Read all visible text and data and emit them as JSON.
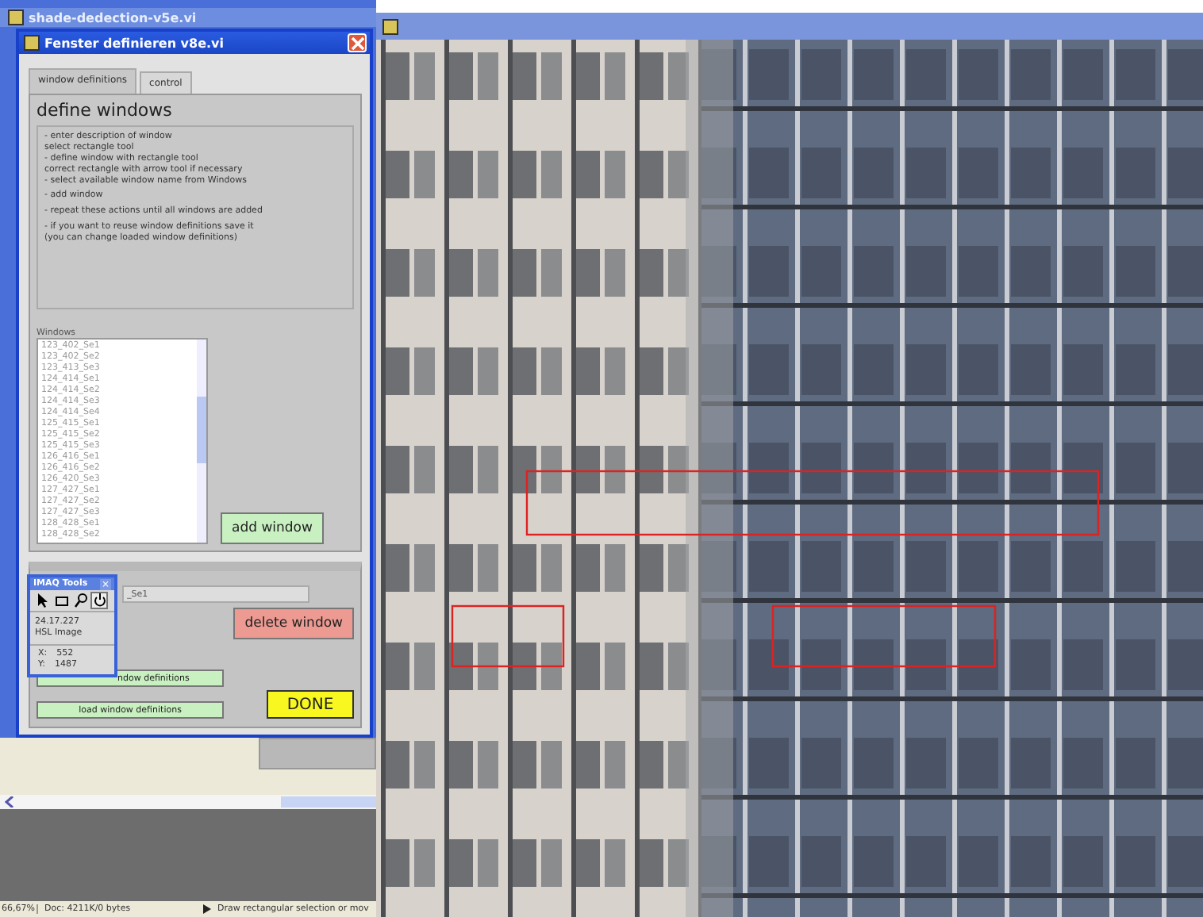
{
  "background_window": {
    "title": "shade-dedection-v5e.vi"
  },
  "dialog": {
    "title": "Fenster definieren v8e.vi",
    "tabs": [
      {
        "label": "window definitions",
        "selected": true
      },
      {
        "label": "control",
        "selected": false
      }
    ],
    "heading": "define windows",
    "instructions": [
      "- enter description of window\nselect rectangle tool\n- define window with rectangle tool\ncorrect rectangle with arrow tool if necessary\n- select available window name from Windows",
      "- add window",
      "- repeat these actions until all windows are added",
      "- if you want to reuse window definitions save it\n(you can change loaded window definitions)"
    ],
    "windows_list": {
      "label": "Windows",
      "items": [
        "123_402_Se1",
        "123_402_Se2",
        "123_413_Se3",
        "124_414_Se1",
        "124_414_Se2",
        "124_414_Se3",
        "124_414_Se4",
        "125_415_Se1",
        "125_415_Se2",
        "125_415_Se3",
        "126_416_Se1",
        "126_416_Se2",
        "126_420_Se3",
        "127_427_Se1",
        "127_427_Se2",
        "127_427_Se3",
        "128_428_Se1",
        "128_428_Se2"
      ]
    },
    "add_button": "add window",
    "name_field": {
      "value": "_Se1"
    },
    "delete_button": "delete window",
    "save_button": "ndow definitions",
    "load_button": "load window definitions",
    "done_button": "DONE"
  },
  "tools_palette": {
    "title": "IMAQ Tools",
    "close": "×",
    "tools": [
      {
        "kind": "arrow",
        "selected": false
      },
      {
        "kind": "rectangle",
        "selected": false
      },
      {
        "kind": "zoom",
        "selected": false
      },
      {
        "kind": "pan",
        "selected": true
      }
    ],
    "image_size": "24.17.227",
    "image_type": "HSL Image",
    "x_label": "X:",
    "x_value": "552",
    "y_label": "Y:",
    "y_value": "1487"
  },
  "status_bar": {
    "zoom": "66,67%",
    "doc": "Doc: 4211K/0 bytes",
    "hint": "Draw rectangular selection or mov"
  }
}
